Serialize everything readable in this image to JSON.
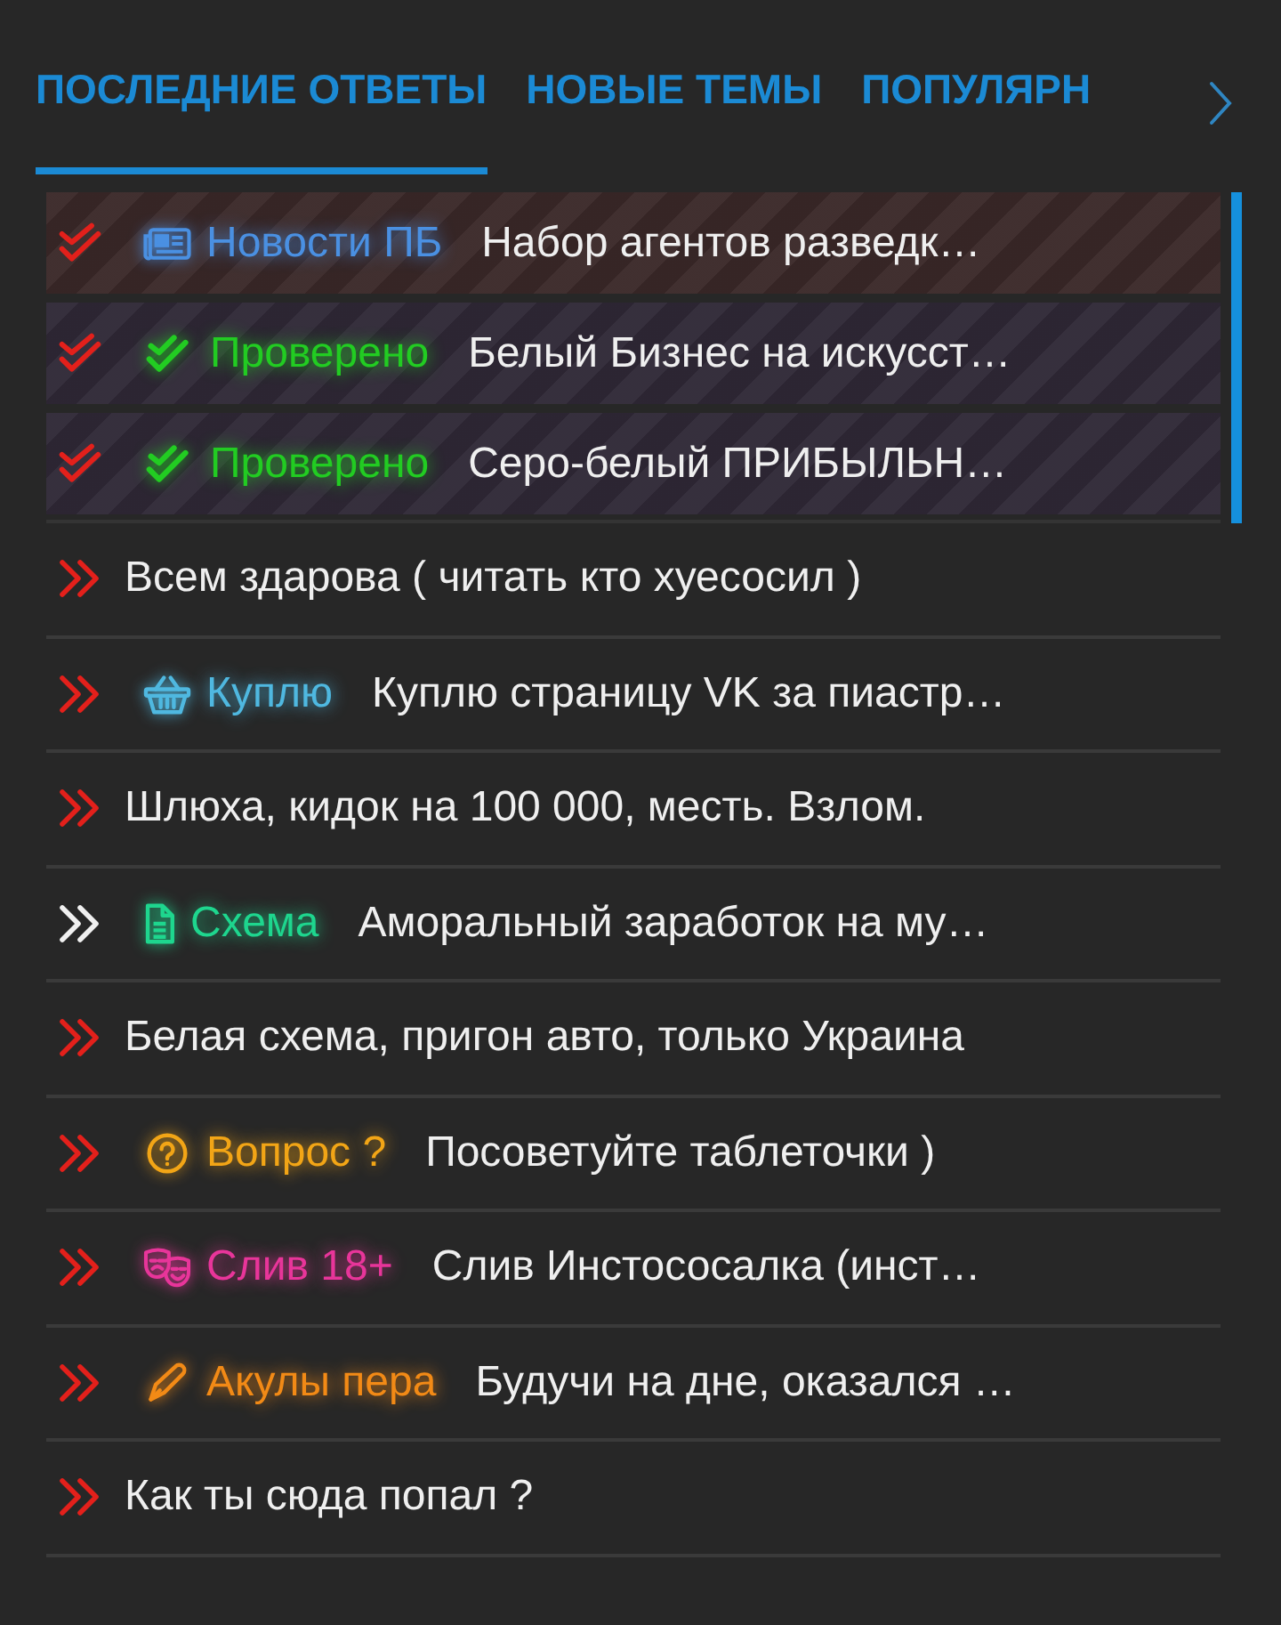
{
  "tabs": [
    {
      "label": "ПОСЛЕДНИЕ ОТВЕТЫ",
      "selected": true
    },
    {
      "label": "НОВЫЕ ТЕМЫ",
      "selected": false
    },
    {
      "label": "ПОПУЛЯРН",
      "selected": false
    }
  ],
  "rows": [
    {
      "kind": "pinned",
      "unread": true,
      "color": "#3a2828",
      "prefix": {
        "kind": "news",
        "label": "Новости ПБ",
        "color": "#4a90e2"
      },
      "title": "Набор агентов разведк…"
    },
    {
      "kind": "pinned",
      "unread": true,
      "color": "#2f2836",
      "prefix": {
        "kind": "verified",
        "label": "Проверено",
        "color": "#22cc22"
      },
      "title": "Белый Бизнес на искусст…"
    },
    {
      "kind": "pinned",
      "unread": true,
      "color": "#2f2836",
      "prefix": {
        "kind": "verified",
        "label": "Проверено",
        "color": "#22cc22"
      },
      "title": "Серо-белый ПРИБЫЛЬН…"
    },
    {
      "kind": "topic",
      "unread": true,
      "title": "Всем здарова ( читать кто хуесосил )"
    },
    {
      "kind": "topic",
      "unread": true,
      "prefix": {
        "kind": "buy",
        "label": "Куплю",
        "color": "#4fb8e0"
      },
      "title": "Куплю страницу VK за пиастр…"
    },
    {
      "kind": "topic",
      "unread": true,
      "title": "Шлюха, кидок на 100 000, месть. Взлом."
    },
    {
      "kind": "topic",
      "unread": false,
      "prefix": {
        "kind": "scheme",
        "label": "Схема",
        "color": "#1ed68e"
      },
      "title": "Аморальный заработок на му…"
    },
    {
      "kind": "topic",
      "unread": true,
      "title": "Белая схема, пригон авто, только Украина"
    },
    {
      "kind": "topic",
      "unread": true,
      "prefix": {
        "kind": "question",
        "label": "Вопрос ?",
        "color": "#f2a516"
      },
      "title": "Посоветуйте таблеточки )"
    },
    {
      "kind": "topic",
      "unread": true,
      "prefix": {
        "kind": "leak",
        "label": "Слив 18+",
        "color": "#e8359a"
      },
      "title": "Слив Инстососалка (инст…"
    },
    {
      "kind": "topic",
      "unread": true,
      "prefix": {
        "kind": "writers",
        "label": "Акулы пера",
        "color": "#f28a16"
      },
      "title": "Будучи на дне, оказался …"
    },
    {
      "kind": "topic",
      "unread": true,
      "title": "Как ты сюда попал ?"
    }
  ]
}
